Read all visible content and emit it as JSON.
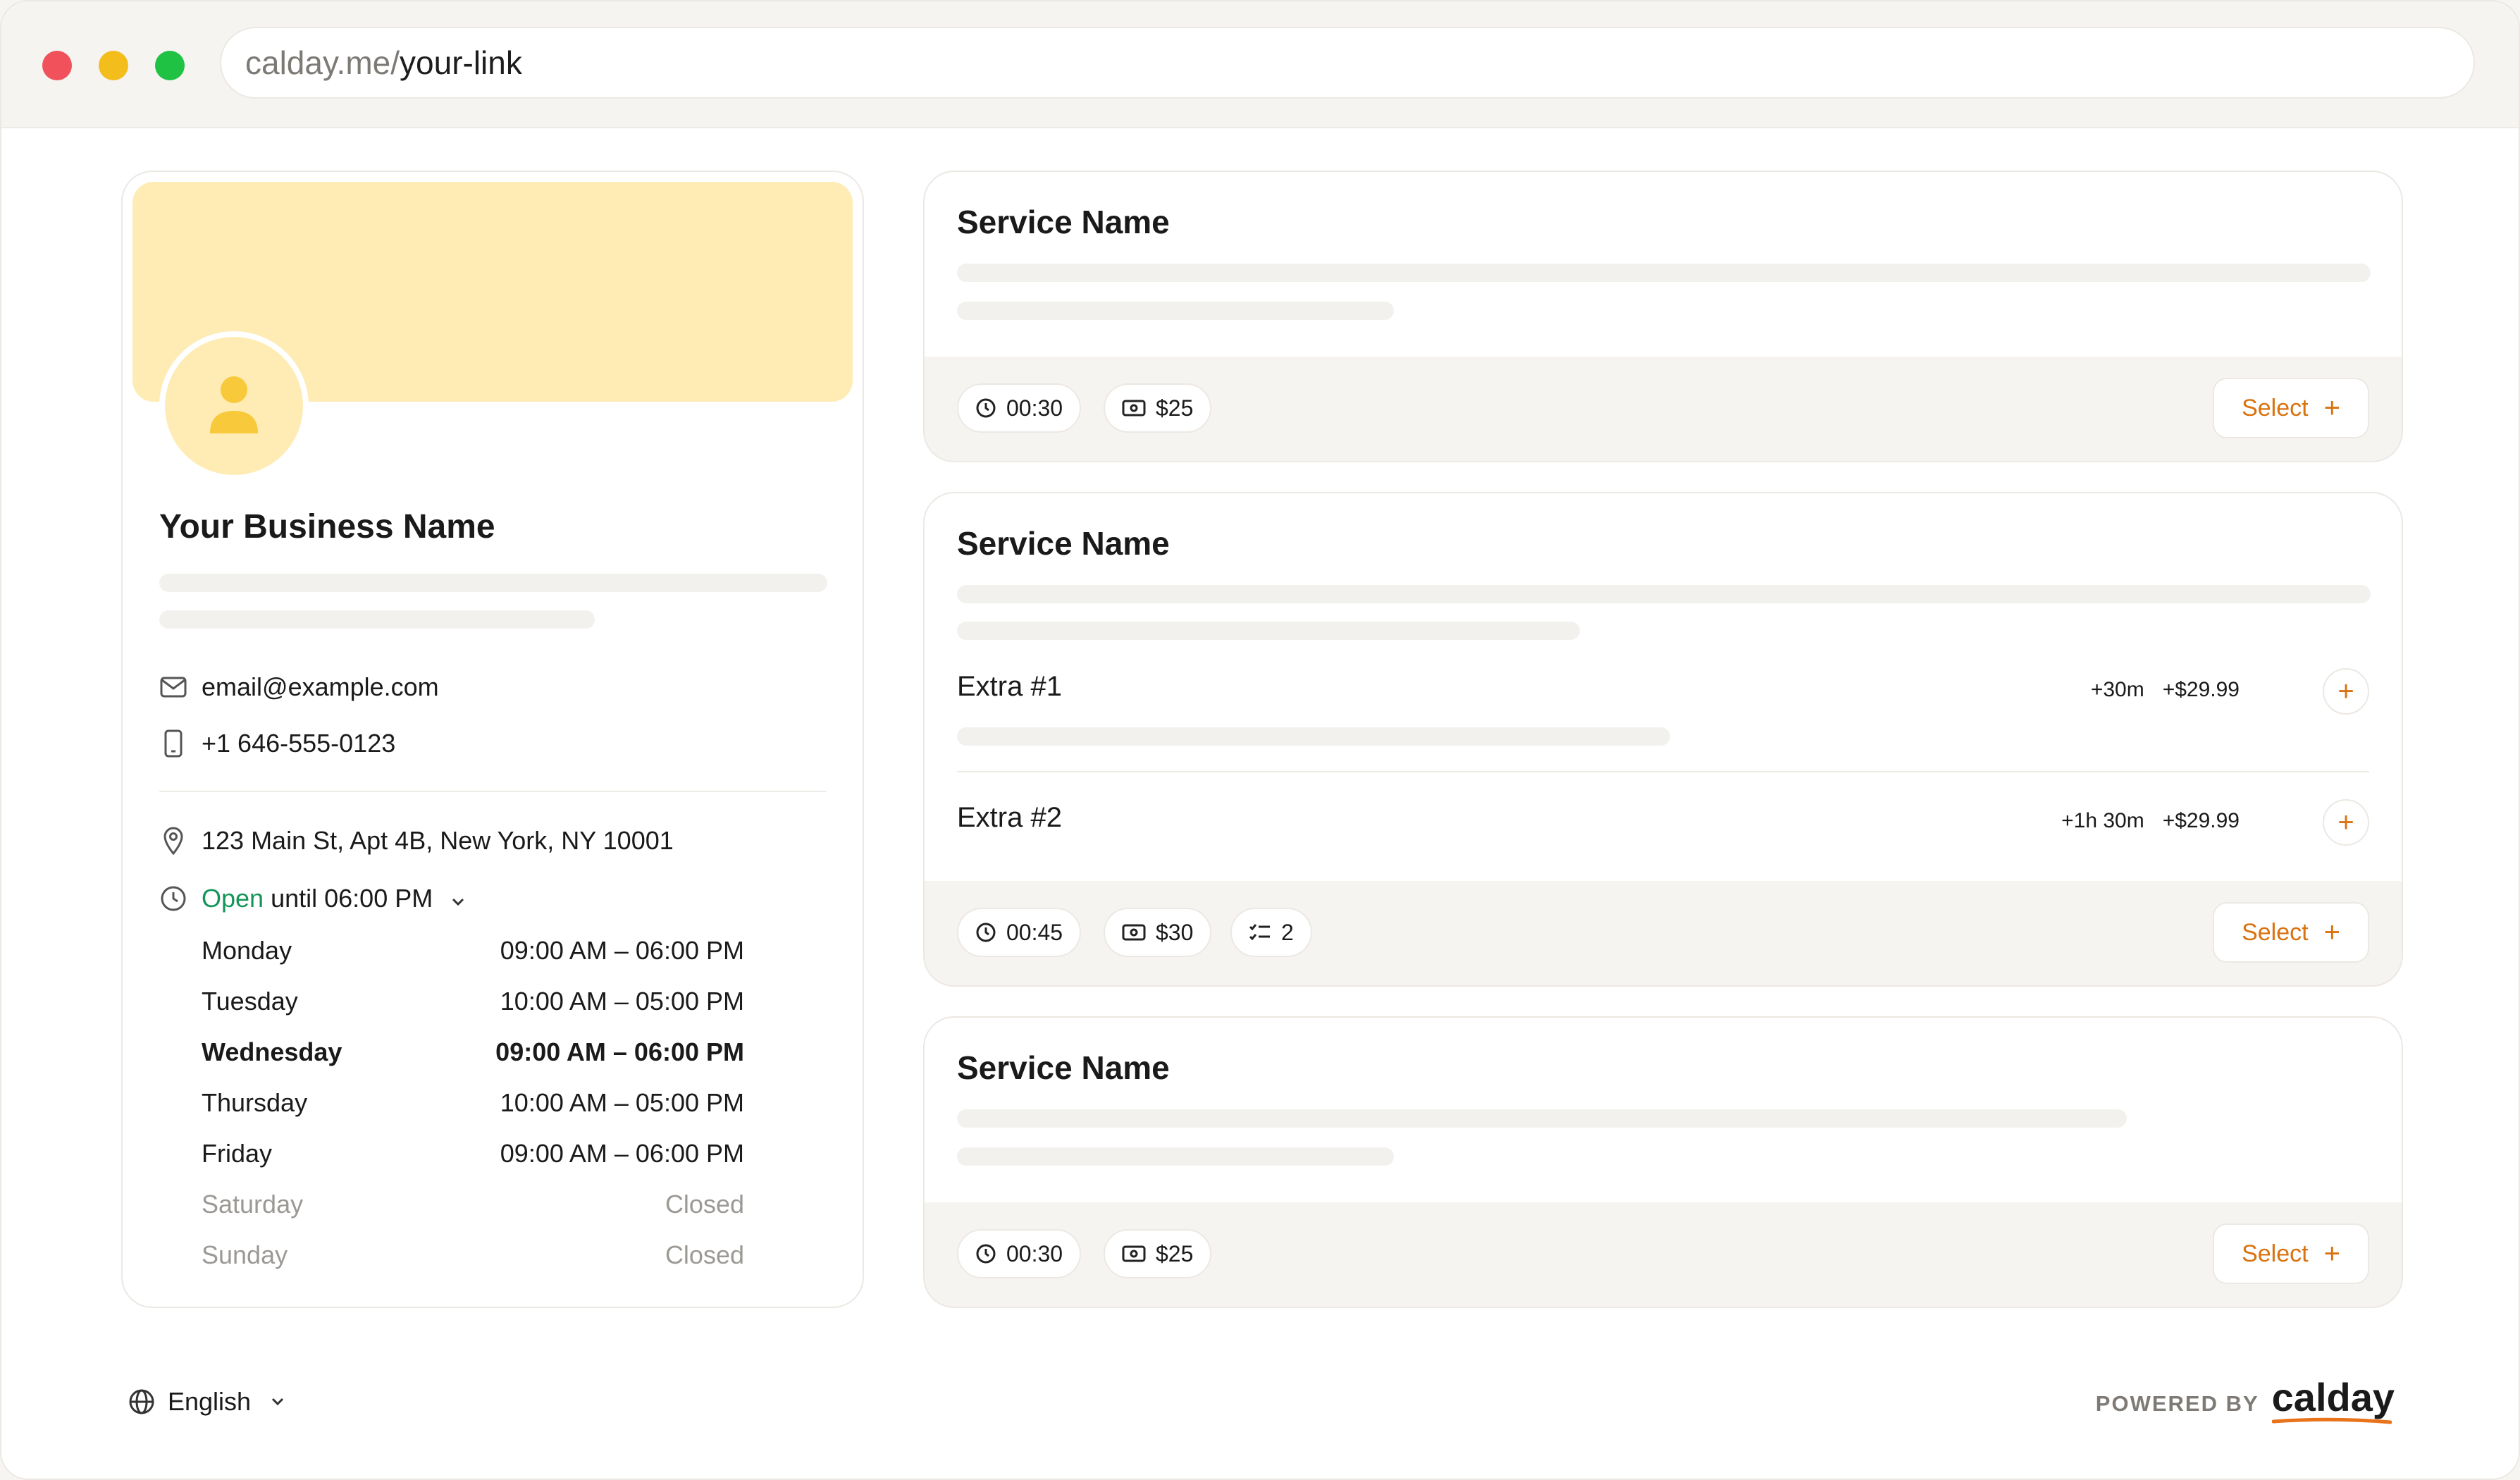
{
  "browser": {
    "url_host": "calday.me/",
    "url_path": "your-link"
  },
  "profile": {
    "business_name": "Your Business Name",
    "email": "email@example.com",
    "phone": "+1 646-555-0123",
    "address": "123 Main St, Apt 4B, New York, NY 10001",
    "status_open": "Open",
    "status_until": " until 06:00 PM",
    "hours": [
      {
        "day": "Monday",
        "time": "09:00 AM – 06:00 PM"
      },
      {
        "day": "Tuesday",
        "time": "10:00 AM – 05:00 PM"
      },
      {
        "day": "Wednesday",
        "time": "09:00 AM – 06:00 PM"
      },
      {
        "day": "Thursday",
        "time": "10:00 AM – 05:00 PM"
      },
      {
        "day": "Friday",
        "time": "09:00 AM – 06:00 PM"
      },
      {
        "day": "Saturday",
        "time": "Closed"
      },
      {
        "day": "Sunday",
        "time": "Closed"
      }
    ]
  },
  "services": [
    {
      "title": "Service Name",
      "duration": "00:30",
      "price": "$25",
      "select_label": "Select"
    },
    {
      "title": "Service Name",
      "extras": [
        {
          "title": "Extra #1",
          "time": "+30m",
          "price": "+$29.99"
        },
        {
          "title": "Extra #2",
          "time": "+1h 30m",
          "price": "+$29.99"
        }
      ],
      "duration": "00:45",
      "price": "$30",
      "extras_count": "2",
      "select_label": "Select"
    },
    {
      "title": "Service Name",
      "duration": "00:30",
      "price": "$25",
      "select_label": "Select"
    }
  ],
  "footer": {
    "language": "English",
    "powered_by": "POWERED BY",
    "brand": "calday"
  },
  "colors": {
    "accent": "#d9720f",
    "open": "#15955a",
    "banner": "#feecb4"
  }
}
